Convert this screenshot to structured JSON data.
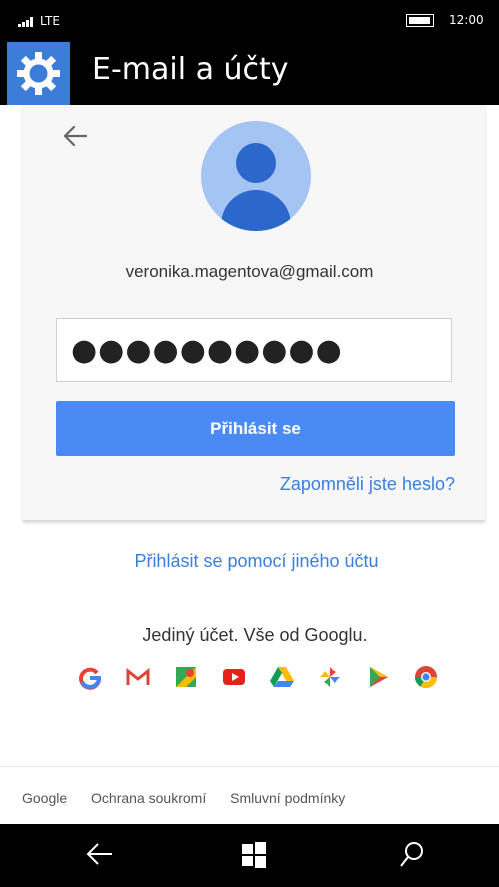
{
  "status_bar": {
    "network": "LTE",
    "time": "12:00"
  },
  "title_bar": {
    "title": "E-mail a účty",
    "icon": "gear-icon"
  },
  "signin": {
    "email": "veronika.magentova@gmail.com",
    "password_value": "●●●●●●●●●●",
    "signin_button": "Přihlásit se",
    "forgot_link": "Zapomněli jste heslo?",
    "other_account_link": "Přihlásit se pomocí jiného účtu",
    "tagline": "Jediný účet. Vše od Googlu."
  },
  "google_apps": [
    {
      "name": "google-icon"
    },
    {
      "name": "gmail-icon"
    },
    {
      "name": "maps-icon"
    },
    {
      "name": "youtube-icon"
    },
    {
      "name": "drive-icon"
    },
    {
      "name": "photos-icon"
    },
    {
      "name": "play-icon"
    },
    {
      "name": "chrome-icon"
    }
  ],
  "footer": {
    "links": [
      "Google",
      "Ochrana soukromí",
      "Smluvní podmínky"
    ]
  },
  "nav_bar": {
    "back_icon": "back-icon",
    "start_icon": "windows-start-icon",
    "search_icon": "search-icon"
  },
  "colors": {
    "accent": "#3b7dd8",
    "button": "#4a8af4",
    "link": "#3a7ee0"
  }
}
